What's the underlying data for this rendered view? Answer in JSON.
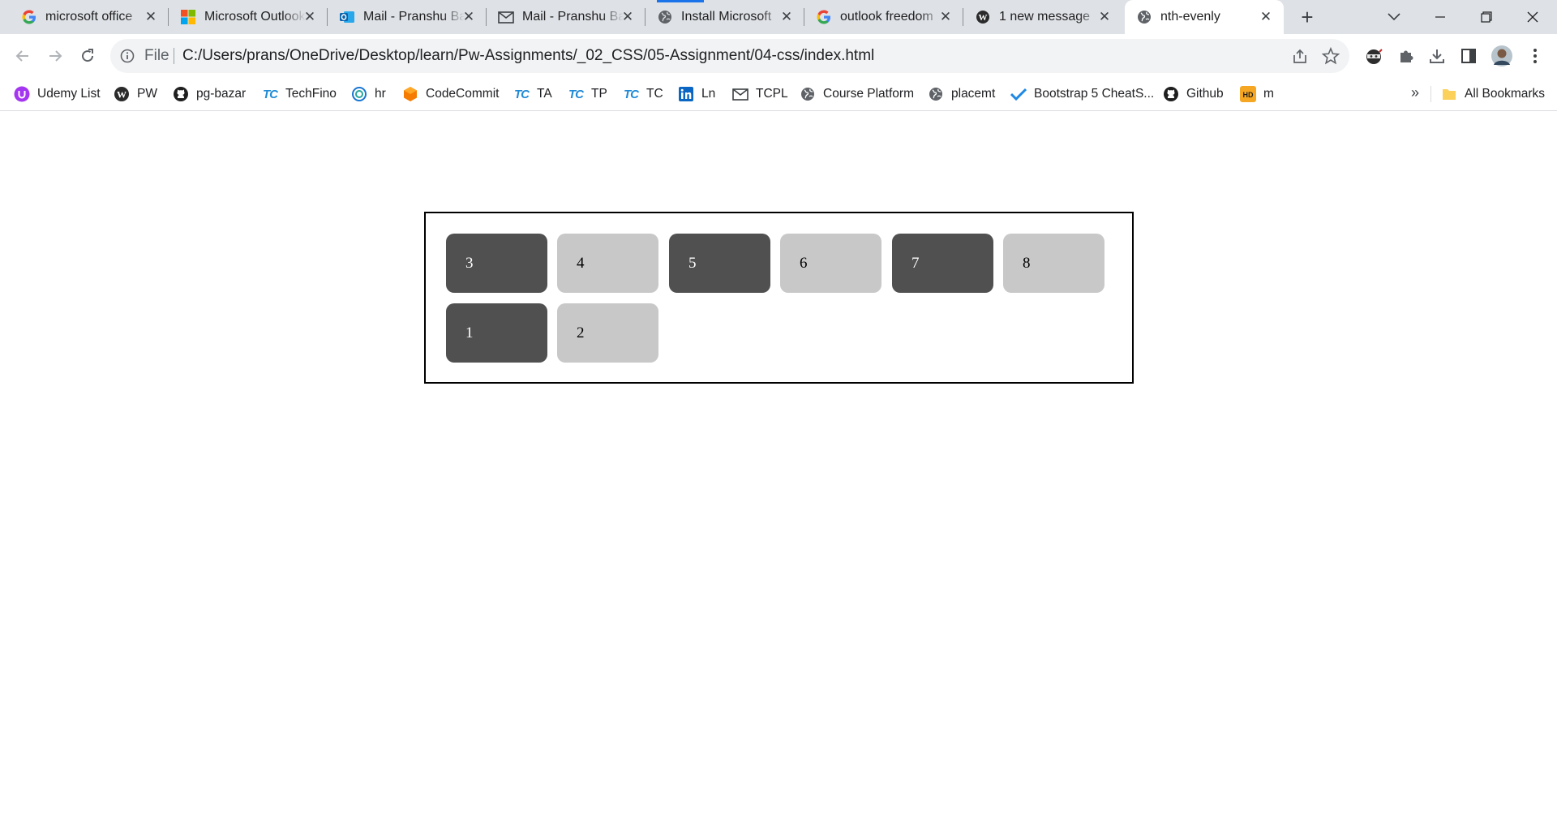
{
  "tabs": [
    {
      "title": "microsoft office",
      "favicon": "google-icon",
      "active": false
    },
    {
      "title": "Microsoft Outlook",
      "favicon": "microsoft-icon",
      "active": false
    },
    {
      "title": "Mail - Pranshu Bansal",
      "favicon": "outlook-icon",
      "active": false
    },
    {
      "title": "Mail - Pranshu Bansal",
      "favicon": "mail-icon",
      "active": false
    },
    {
      "title": "Install Microsoft",
      "favicon": "globe-icon",
      "active": false
    },
    {
      "title": "outlook freedom",
      "favicon": "google-icon",
      "active": false
    },
    {
      "title": "1 new message",
      "favicon": "wordpress-icon",
      "active": false
    },
    {
      "title": "nth-evenly",
      "favicon": "globe-icon",
      "active": true
    }
  ],
  "address_bar": {
    "scheme_label": "File",
    "url": "C:/Users/prans/OneDrive/Desktop/learn/Pw-Assignments/_02_CSS/05-Assignment/04-css/index.html"
  },
  "bookmarks": [
    {
      "label": "Udemy List",
      "icon": "udemy-icon"
    },
    {
      "label": "PW",
      "icon": "wordpress-icon"
    },
    {
      "label": "pg-bazar",
      "icon": "github-icon"
    },
    {
      "label": "TechFino",
      "icon": "tc-logo-icon"
    },
    {
      "label": "hr",
      "icon": "hr-icon"
    },
    {
      "label": "CodeCommit",
      "icon": "codecommit-icon"
    },
    {
      "label": "TA",
      "icon": "tc-logo-icon"
    },
    {
      "label": "TP",
      "icon": "tc-logo-icon"
    },
    {
      "label": "TC",
      "icon": "tc-logo-icon"
    },
    {
      "label": "Ln",
      "icon": "linkedin-icon"
    },
    {
      "label": "TCPL",
      "icon": "mail-icon"
    },
    {
      "label": "Course Platform",
      "icon": "globe-icon"
    },
    {
      "label": "placemt",
      "icon": "globe-icon"
    },
    {
      "label": "Bootstrap 5 CheatS...",
      "icon": "checkmark-icon"
    },
    {
      "label": "Github",
      "icon": "github-icon"
    },
    {
      "label": "m",
      "icon": "hd-icon"
    }
  ],
  "bookmarks_overflow": "»",
  "all_bookmarks_label": "All Bookmarks",
  "page": {
    "boxes": [
      {
        "label": "3",
        "shade": "dark"
      },
      {
        "label": "4",
        "shade": "light"
      },
      {
        "label": "5",
        "shade": "dark"
      },
      {
        "label": "6",
        "shade": "light"
      },
      {
        "label": "7",
        "shade": "dark"
      },
      {
        "label": "8",
        "shade": "light"
      },
      {
        "label": "1",
        "shade": "dark"
      },
      {
        "label": "2",
        "shade": "light"
      }
    ]
  },
  "colors": {
    "tab_strip": "#dee1e6",
    "box_dark": "#505050",
    "box_light": "#c9c8c8",
    "container_border": "#000000",
    "accent": "#1a73e8"
  }
}
